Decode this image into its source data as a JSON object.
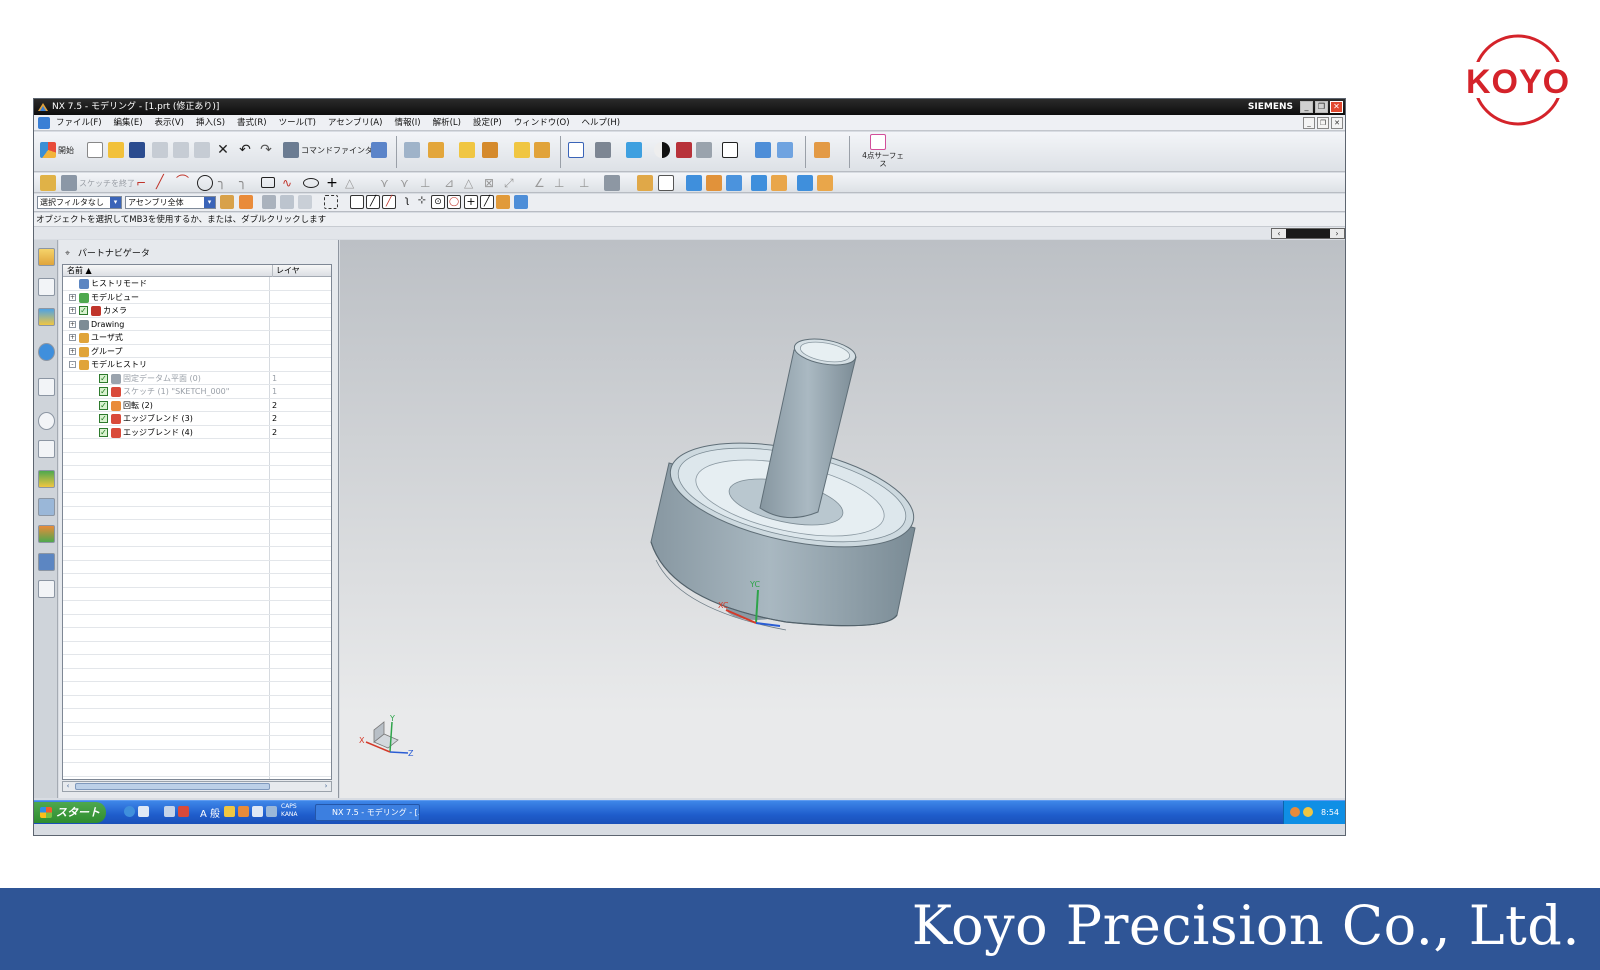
{
  "window": {
    "title": "NX 7.5 - モデリング - [1.prt (修正あり)]",
    "brand": "SIEMENS"
  },
  "menu": [
    "ファイル(F)",
    "編集(E)",
    "表示(V)",
    "挿入(S)",
    "書式(R)",
    "ツール(T)",
    "アセンブリ(A)",
    "情報(I)",
    "解析(L)",
    "設定(P)",
    "ウィンドウ(O)",
    "ヘルプ(H)"
  ],
  "toolbar": {
    "start_label": "開始",
    "command_finder": "コマンドファインダ",
    "four_point_surface": "4点サーフェス",
    "finish_sketch": "スケッチを終了"
  },
  "selection": {
    "filter": "選択フィルタなし",
    "scope": "アセンブリ全体"
  },
  "status_message": "オブジェクトを選択してMB3を使用するか、または、ダブルクリックします",
  "navigator": {
    "title": "パートナビゲータ",
    "col_name": "名前",
    "col_layer": "レイヤ",
    "rows": [
      {
        "label": "ヒストリモード",
        "layer": "",
        "level": 0,
        "expander": "",
        "check": false,
        "grey": false
      },
      {
        "label": "モデルビュー",
        "layer": "",
        "level": 0,
        "expander": "+",
        "check": false,
        "grey": false
      },
      {
        "label": "カメラ",
        "layer": "",
        "level": 0,
        "expander": "+",
        "check": true,
        "grey": false
      },
      {
        "label": "Drawing",
        "layer": "",
        "level": 0,
        "expander": "+",
        "check": false,
        "grey": false
      },
      {
        "label": "ユーザ式",
        "layer": "",
        "level": 0,
        "expander": "+",
        "check": false,
        "grey": false
      },
      {
        "label": "グループ",
        "layer": "",
        "level": 0,
        "expander": "+",
        "check": false,
        "grey": false
      },
      {
        "label": "モデルヒストリ",
        "layer": "",
        "level": 0,
        "expander": "-",
        "check": false,
        "grey": false
      },
      {
        "label": "固定データム平面 (0)",
        "layer": "1",
        "level": 1,
        "expander": "",
        "check": true,
        "grey": true
      },
      {
        "label": "スケッチ (1) \"SKETCH_000\"",
        "layer": "1",
        "level": 1,
        "expander": "",
        "check": true,
        "grey": true
      },
      {
        "label": "回転 (2)",
        "layer": "2",
        "level": 1,
        "expander": "",
        "check": true,
        "grey": false
      },
      {
        "label": "エッジブレンド (3)",
        "layer": "2",
        "level": 1,
        "expander": "",
        "check": true,
        "grey": false
      },
      {
        "label": "エッジブレンド (4)",
        "layer": "2",
        "level": 1,
        "expander": "",
        "check": true,
        "grey": false
      }
    ],
    "empty_rows": 26
  },
  "viewport": {
    "axis_labels": {
      "x": "X",
      "y": "Y",
      "z": "Z",
      "yc": "YC",
      "xc": "XC"
    }
  },
  "taskbar": {
    "start": "スタート",
    "ime": "A 般",
    "caps": "CAPS KANA",
    "task": "NX 7.5 - モデリング - [...",
    "clock": "8:54"
  },
  "slide": {
    "logo": "KOYO",
    "footer": "Koyo Precision Co., Ltd."
  },
  "colors": {
    "footer_band": "#2f5596",
    "logo_red": "#d4232a",
    "part_body": "#8fa2ae"
  }
}
